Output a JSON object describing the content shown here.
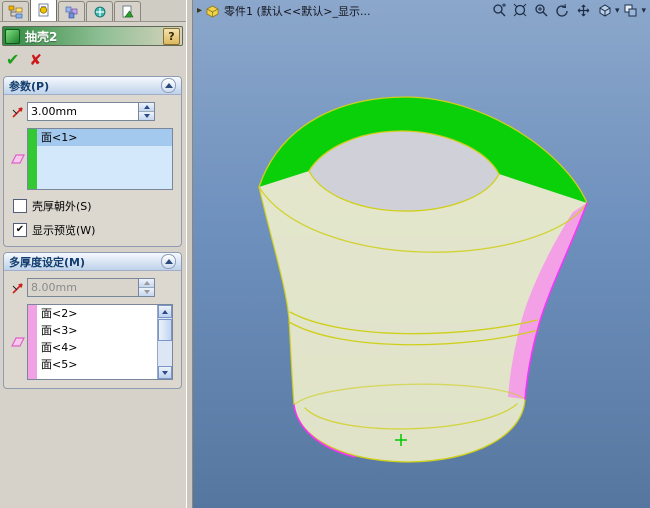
{
  "icons": {
    "ok": "✔",
    "cancel": "✘",
    "check": "✔",
    "help": "?",
    "caret_down": "▾",
    "flyout": "▸"
  },
  "colors": {
    "selection_green": "#0ad00a",
    "multi_face_pink": "#f49ae8",
    "edge_yellow": "#cfcf1a",
    "edge_magenta": "#ff30ff",
    "viewport_top": "#8ba7cb",
    "viewport_bottom": "#55779f"
  },
  "manager_tabs": [
    {
      "name": "featuremanager-tree-tab",
      "active": false
    },
    {
      "name": "propertymanager-tab",
      "active": true
    },
    {
      "name": "configurationmanager-tab",
      "active": false
    },
    {
      "name": "dimxpertmanager-tab",
      "active": false
    },
    {
      "name": "displaymanager-tab",
      "active": false
    }
  ],
  "property_manager": {
    "title": "抽壳2",
    "parameters": {
      "header": "参数(P)",
      "thickness_value": "3.00mm",
      "face_list": [
        "面<1>"
      ],
      "shell_outward": {
        "label": "壳厚朝外(S)",
        "checked": false
      },
      "show_preview": {
        "label": "显示预览(W)",
        "checked": true
      }
    },
    "multi_thickness": {
      "header": "多厚度设定(M)",
      "thickness_value": "8.00mm",
      "thickness_enabled": false,
      "face_list": [
        "面<2>",
        "面<3>",
        "面<4>",
        "面<5>"
      ]
    }
  },
  "viewport": {
    "document_title": "零件1 (默认<<默认>_显示...",
    "toolbar_icons": [
      "zoom-area-icon",
      "zoom-fit-icon",
      "zoom-in-out-icon",
      "rotate-view-icon",
      "pan-view-icon",
      "display-style-icon",
      "view-orientation-icon"
    ]
  }
}
